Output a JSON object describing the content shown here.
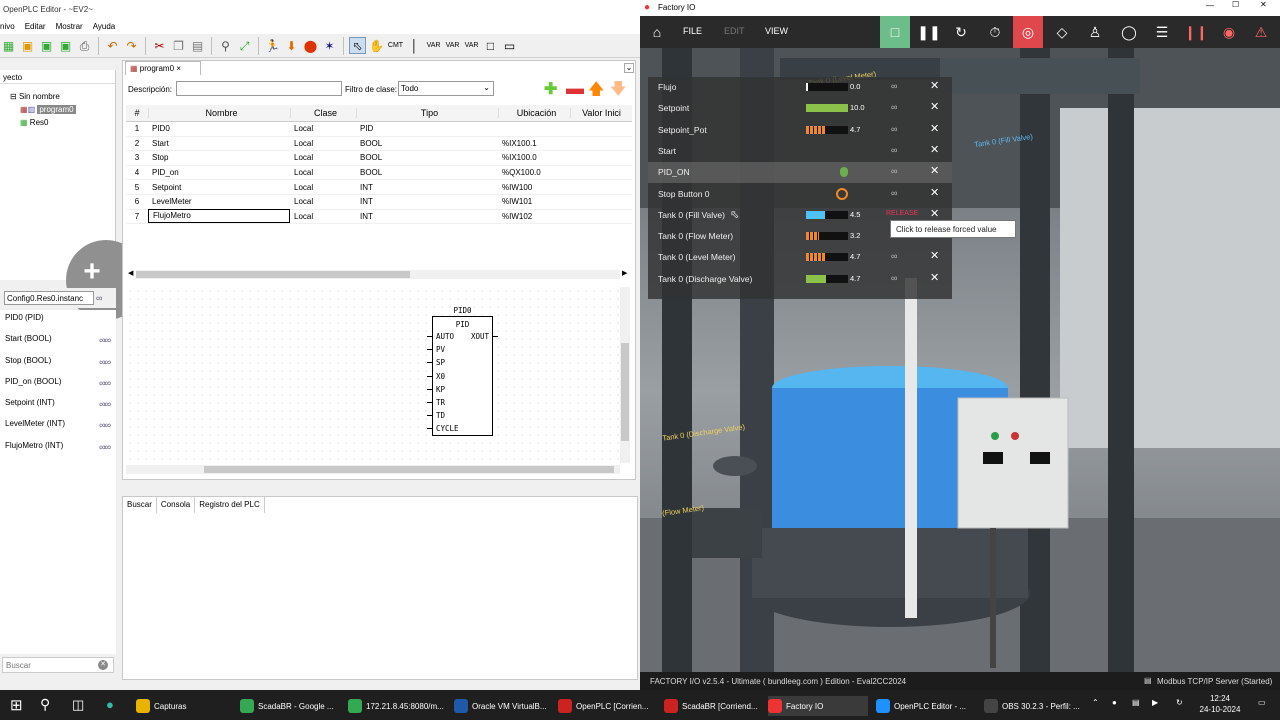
{
  "plc": {
    "title": "OpenPLC Editor - ~EV2~",
    "menu": [
      "nivo",
      "Editar",
      "Mostrar",
      "Ayuda"
    ],
    "project_tab": "yecto",
    "tree": {
      "root": "Sin nombre",
      "program": "program0",
      "resource": "Res0"
    },
    "editor_tab": "program0",
    "desc_label": "Descripción:",
    "filter_label": "Filtro de clase:",
    "filter_value": "Todo",
    "columns": [
      "#",
      "Nombre",
      "Clase",
      "Tipo",
      "Ubicación",
      "Valor Inici"
    ],
    "variables": [
      {
        "n": "1",
        "name": "PID0",
        "clase": "Local",
        "tipo": "PID",
        "ubic": ""
      },
      {
        "n": "2",
        "name": "Start",
        "clase": "Local",
        "tipo": "BOOL",
        "ubic": "%IX100.1"
      },
      {
        "n": "3",
        "name": "Stop",
        "clase": "Local",
        "tipo": "BOOL",
        "ubic": "%IX100.0"
      },
      {
        "n": "4",
        "name": "PID_on",
        "clase": "Local",
        "tipo": "BOOL",
        "ubic": "%QX100.0"
      },
      {
        "n": "5",
        "name": "Setpoint",
        "clase": "Local",
        "tipo": "INT",
        "ubic": "%IW100"
      },
      {
        "n": "6",
        "name": "LevelMeter",
        "clase": "Local",
        "tipo": "INT",
        "ubic": "%IW101"
      },
      {
        "n": "7",
        "name": "FlujoMetro",
        "clase": "Local",
        "tipo": "INT",
        "ubic": "%IW102"
      }
    ],
    "block": {
      "instance": "PID0",
      "type": "PID",
      "inputs": [
        "AUTO",
        "PV",
        "SP",
        "X0",
        "KP",
        "TR",
        "TD",
        "CYCLE"
      ],
      "output": "XOUT"
    },
    "debug_select": "Config0.Res0.instanc",
    "debug_items": [
      "PID0 (PID)",
      "Start (BOOL)",
      "Stop (BOOL)",
      "PID_on (BOOL)",
      "Setpoint (INT)",
      "LevelMeter (INT)",
      "FlujoMetro (INT)"
    ],
    "search_placeholder": "Buscar",
    "console_tabs": [
      "Buscar",
      "Consola",
      "Registro del PLC"
    ]
  },
  "fio": {
    "title": "Factory IO",
    "nav": {
      "file": "FILE",
      "edit": "EDIT",
      "view": "VIEW"
    },
    "tags": [
      {
        "name": "Flujo",
        "value": "0.0",
        "fill": 0.0,
        "color": "#ffffff",
        "kind": "bar"
      },
      {
        "name": "Setpoint",
        "value": "10.0",
        "fill": 1.0,
        "color": "#8bc34a",
        "kind": "bar"
      },
      {
        "name": "Setpoint_Pot",
        "value": "4.7",
        "fill": 0.47,
        "color": "#f08a24",
        "kind": "bar"
      },
      {
        "name": "Start",
        "value": "",
        "fill": 0,
        "color": "",
        "kind": "none"
      },
      {
        "name": "PID_ON",
        "value": "",
        "fill": 0,
        "color": "#6ab04c",
        "kind": "bool"
      },
      {
        "name": "Stop Button 0",
        "value": "",
        "fill": 0,
        "color": "#f08a24",
        "kind": "button"
      },
      {
        "name": "Tank 0 (Fill Valve)",
        "value": "4.5",
        "fill": 0.45,
        "color": "#4fc3f7",
        "kind": "bar"
      },
      {
        "name": "Tank 0 (Flow Meter)",
        "value": "3.2",
        "fill": 0.32,
        "color": "#f08a24",
        "kind": "bar"
      },
      {
        "name": "Tank 0 (Level Meter)",
        "value": "4.7",
        "fill": 0.47,
        "color": "#f08a24",
        "kind": "bar"
      },
      {
        "name": "Tank 0 (Discharge Valve)",
        "value": "4.7",
        "fill": 0.47,
        "color": "#8bc34a",
        "kind": "bar"
      }
    ],
    "release_label": "RELEASE",
    "tooltip": "Click to release forced value",
    "scene_labels": {
      "level": "Tank 0 (Level Meter)",
      "fill": "Tank 0 (Fill Valve)",
      "discharge": "Tank 0 (Discharge Valve)",
      "flow": "(Flow Meter)"
    },
    "status_left": "FACTORY I/O v2.5.4 - Ultimate ( bundleeg.com ) Edition - Eval2CC2024",
    "status_right": "Modbus TCP/IP Server (Started)"
  },
  "taskbar": {
    "apps": [
      "Capturas",
      "ScadaBR - Google ...",
      "172.21.8.45:8080/m...",
      "Oracle VM VirtualB...",
      "OpenPLC [Corrien...",
      "ScadaBR [Corriend...",
      "Factory IO",
      "OpenPLC Editor - ...",
      "OBS 30.2.3 - Perfil: ..."
    ],
    "time": "12:24",
    "date": "24-10-2024"
  }
}
